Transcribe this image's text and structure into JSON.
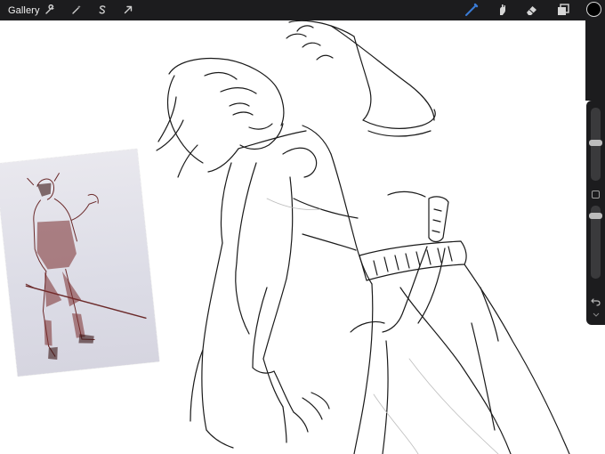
{
  "toolbar": {
    "gallery_label": "Gallery",
    "left_tools": [
      "wrench-icon",
      "magic-wand-icon",
      "selection-s-icon",
      "transform-arrow-icon"
    ],
    "right_tools": [
      "brush-icon",
      "smudge-icon",
      "eraser-icon",
      "layers-icon"
    ],
    "accent_color": "#3a7bd5",
    "current_color": "#000000"
  },
  "sidebar": {
    "controls": [
      "brush-size-slider",
      "modify-button",
      "opacity-slider",
      "undo-button",
      "redo-button"
    ]
  }
}
